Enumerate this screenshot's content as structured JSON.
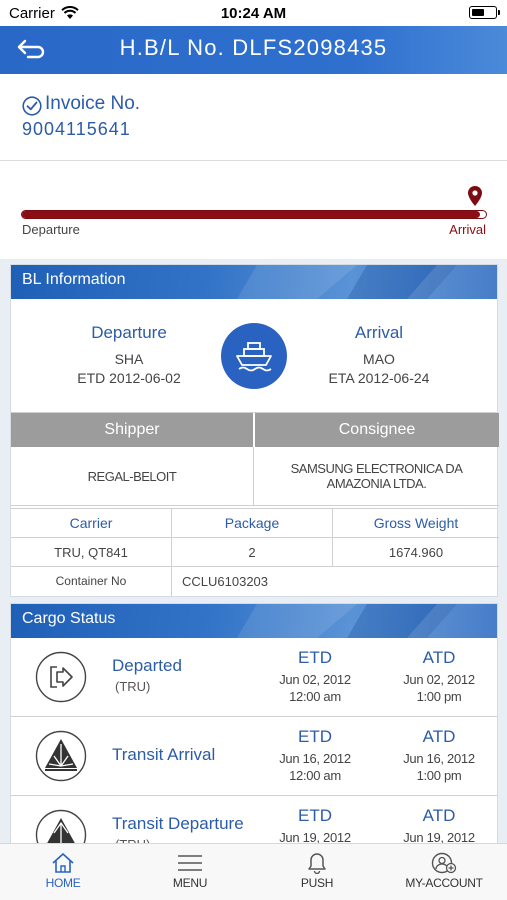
{
  "status_bar": {
    "carrier": "Carrier",
    "time": "10:24 AM",
    "battery_level": 0.55
  },
  "header": {
    "title": "H.B/L No. DLFS2098435"
  },
  "invoice": {
    "label": "Invoice No.",
    "number": "9004115641"
  },
  "progress": {
    "departure_label": "Departure",
    "arrival_label": "Arrival",
    "fraction": 1.0
  },
  "bl_info": {
    "title": "BL Information",
    "departure": {
      "heading": "Departure",
      "port": "SHA",
      "date_label": "ETD",
      "date": "2012-06-02"
    },
    "arrival": {
      "heading": "Arrival",
      "port": "MAO",
      "date_label": "ETA",
      "date": "2012-06-24"
    },
    "shipper_header": "Shipper",
    "consignee_header": "Consignee",
    "shipper": "REGAL-BELOIT",
    "consignee": "SAMSUNG ELECTRONICA DA AMAZONIA LTDA.",
    "columns": [
      "Carrier",
      "Package",
      "Gross Weight"
    ],
    "values": [
      "TRU, QT841",
      "2",
      "1674.960"
    ],
    "container_label": "Container No",
    "container": "CCLU6103203"
  },
  "cargo": {
    "title": "Cargo Status",
    "rows": [
      {
        "name": "Departed",
        "sub": "(TRU)",
        "etd_label": "ETD",
        "etd_date": "Jun 02, 2012",
        "etd_time": "12:00 am",
        "atd_label": "ATD",
        "atd_date": "Jun 02, 2012",
        "atd_time": "1:00 pm"
      },
      {
        "name": "Transit Arrival",
        "sub": "",
        "etd_label": "ETD",
        "etd_date": "Jun 16, 2012",
        "etd_time": "12:00 am",
        "atd_label": "ATD",
        "atd_date": "Jun 16, 2012",
        "atd_time": "1:00 pm"
      },
      {
        "name": "Transit Departure",
        "sub": "(TRU)",
        "etd_label": "ETD",
        "etd_date": "Jun 19, 2012",
        "etd_time": "",
        "atd_label": "ATD",
        "atd_date": "Jun 19, 2012",
        "atd_time": ""
      }
    ]
  },
  "tabs": [
    {
      "label": "HOME",
      "icon": "home-icon",
      "active": true
    },
    {
      "label": "MENU",
      "icon": "menu-icon",
      "active": false
    },
    {
      "label": "PUSH",
      "icon": "bell-icon",
      "active": false
    },
    {
      "label": "MY-ACCOUNT",
      "icon": "account-icon",
      "active": false
    }
  ],
  "colors": {
    "primary": "#2a62c1",
    "progress": "#8a0e14",
    "table_header": "#9c9c9c"
  }
}
